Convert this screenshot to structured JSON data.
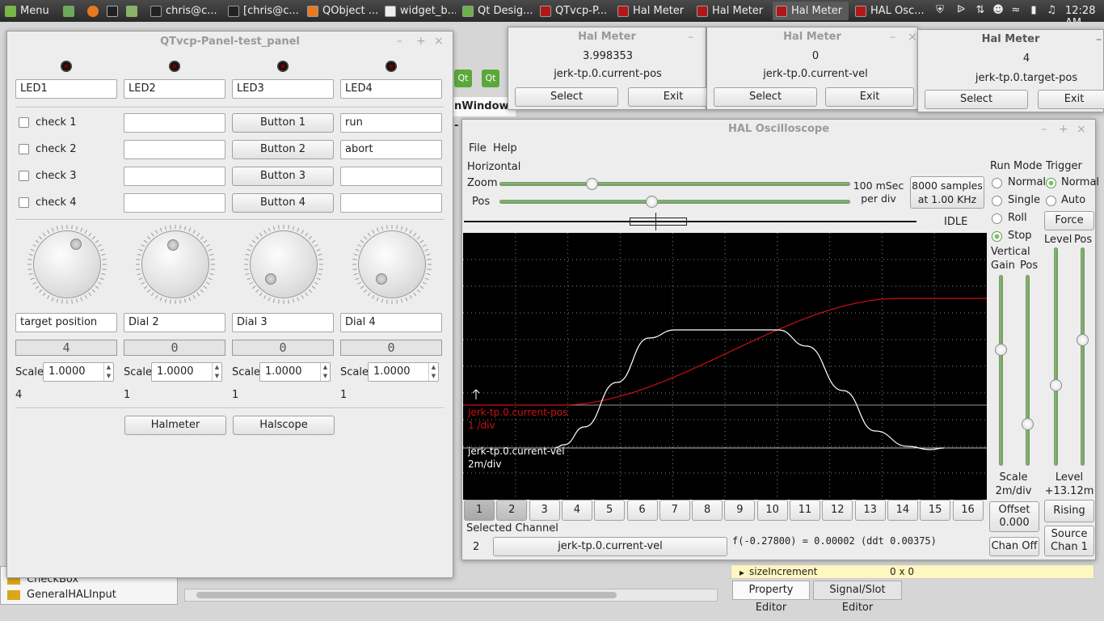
{
  "taskbar": {
    "menu_label": "Menu",
    "clock": "12:28 AM",
    "tasks": [
      "chris@c...",
      "[chris@c...",
      "QObject ...",
      "widget_b...",
      "Qt Desig...",
      "QTvcp-P...",
      "Hal Meter",
      "Hal Meter",
      "Hal Meter",
      "HAL Osc..."
    ]
  },
  "background": {
    "menu_fragment": "nWindow -",
    "designer_items": [
      "CheckBox",
      "GeneralHALInput"
    ],
    "property_row": {
      "name": "sizeIncrement",
      "value": "0 x 0"
    },
    "tabs": [
      "Property Editor",
      "Signal/Slot Editor"
    ]
  },
  "panel": {
    "title": "QTvcp-Panel-test_panel",
    "leds": [
      "LED1",
      "LED2",
      "LED3",
      "LED4"
    ],
    "checks": [
      "check 1",
      "check 2",
      "check 3",
      "check 4"
    ],
    "mid_fields": [
      "",
      "",
      "",
      ""
    ],
    "buttons": [
      "Button 1",
      "Button 2",
      "Button 3",
      "Button 4"
    ],
    "right_fields": [
      "run",
      "abort",
      "",
      ""
    ],
    "dial_labels": [
      "target position",
      "Dial 2",
      "Dial 3",
      "Dial 4"
    ],
    "lcd_values": [
      "4",
      "0",
      "0",
      "0"
    ],
    "scale_label": "Scale",
    "scale_values": [
      "1.0000",
      "1.0000",
      "1.0000",
      "1.0000"
    ],
    "dial_values": [
      "4",
      "1",
      "1",
      "1"
    ],
    "halmeter_btn": "Halmeter",
    "halscope_btn": "Halscope"
  },
  "meters": [
    {
      "title": "Hal Meter",
      "value": "3.998353",
      "pin": "jerk-tp.0.current-pos",
      "select": "Select",
      "exit": "Exit"
    },
    {
      "title": "Hal Meter",
      "value": "0",
      "pin": "jerk-tp.0.current-vel",
      "select": "Select",
      "exit": "Exit"
    },
    {
      "title": "Hal Meter",
      "value": "4",
      "pin": "jerk-tp.0.target-pos",
      "select": "Select",
      "exit": "Exit"
    }
  ],
  "scope": {
    "title": "HAL Oscilloscope",
    "menu": [
      "File",
      "Help"
    ],
    "horizontal_label": "Horizontal",
    "zoom_label": "Zoom",
    "pos_label": "Pos",
    "zoom_value": 0.26,
    "pos_value": 0.43,
    "per_div": "100 mSec\nper div",
    "samples": "8000 samples\nat 1.00 KHz",
    "status": "IDLE",
    "run_mode_label": "Run Mode",
    "run_modes": [
      "Normal",
      "Single",
      "Roll",
      "Stop"
    ],
    "run_mode_selected": "Stop",
    "trigger_label": "Trigger",
    "trigger_modes": [
      "Normal",
      "Auto"
    ],
    "trigger_selected": "Normal",
    "force_btn": "Force",
    "level_label": "Level",
    "pos_label2": "Pos",
    "vertical_label": "Vertical",
    "gain_label": "Gain",
    "vpos_label": "Pos",
    "scale_text": "Scale\n2m/div",
    "level_text": "Level\n+13.12m",
    "trace1_name": "jerk-tp.0.current-pos",
    "trace1_scale": "1 /div",
    "trace2_name": "jerk-tp.0.current-vel",
    "trace2_scale": "2m/div",
    "channels": [
      "1",
      "2",
      "3",
      "4",
      "5",
      "6",
      "7",
      "8",
      "9",
      "10",
      "11",
      "12",
      "13",
      "14",
      "15",
      "16"
    ],
    "selected_channel_label": "Selected Channel",
    "selected_channel_num": "2",
    "selected_channel_name": "jerk-tp.0.current-vel",
    "readout": "f(-0.27800) =  0.00002 (ddt  0.00375)",
    "offset_text": "Offset\n0.000",
    "rising_btn": "Rising",
    "chan_off_btn": "Chan Off",
    "source_text": "Source\nChan  1",
    "colors": {
      "trace1": "#cc1111",
      "trace2": "#ffffff",
      "screen": "#000000"
    }
  }
}
